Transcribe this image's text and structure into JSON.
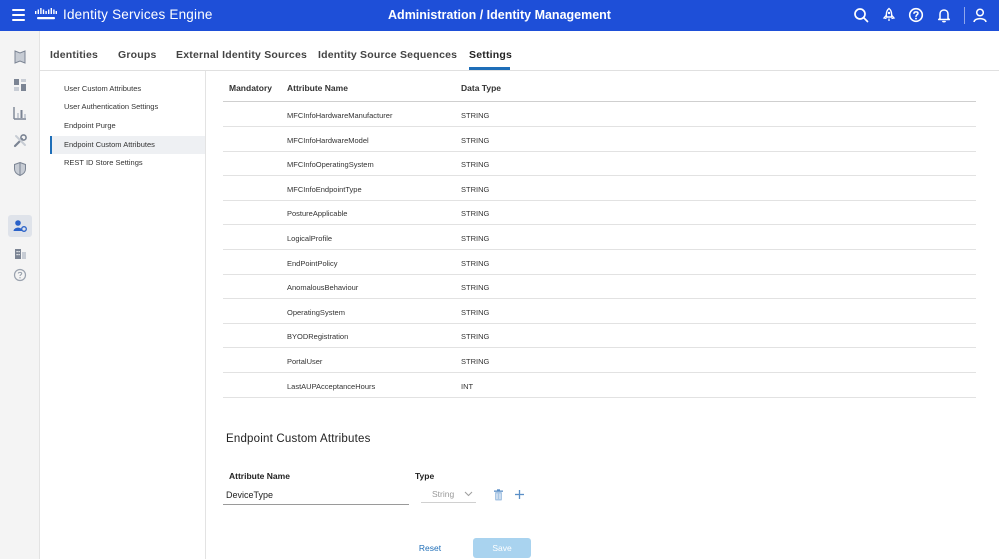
{
  "header": {
    "app_title": "Identity Services Engine",
    "page_heading": "Administration / Identity Management",
    "background": "#1e4fd8"
  },
  "tabs": [
    {
      "label": "Identities"
    },
    {
      "label": "Groups"
    },
    {
      "label": "External Identity Sources"
    },
    {
      "label": "Identity Source Sequences"
    },
    {
      "label": "Settings",
      "active": true
    }
  ],
  "side_menu": {
    "items": [
      {
        "label": "User Custom Attributes"
      },
      {
        "label": "User Authentication Settings"
      },
      {
        "label": "Endpoint Purge"
      },
      {
        "label": "Endpoint Custom Attributes",
        "active": true
      },
      {
        "label": "REST ID Store Settings"
      }
    ]
  },
  "table": {
    "columns": [
      "Mandatory",
      "Attribute Name",
      "Data Type"
    ],
    "rows": [
      {
        "name": "MFCInfoHardwareManufacturer",
        "type": "STRING"
      },
      {
        "name": "MFCInfoHardwareModel",
        "type": "STRING"
      },
      {
        "name": "MFCInfoOperatingSystem",
        "type": "STRING"
      },
      {
        "name": "MFCInfoEndpointType",
        "type": "STRING"
      },
      {
        "name": "PostureApplicable",
        "type": "STRING"
      },
      {
        "name": "LogicalProfile",
        "type": "STRING"
      },
      {
        "name": "EndPointPolicy",
        "type": "STRING"
      },
      {
        "name": "AnomalousBehaviour",
        "type": "STRING"
      },
      {
        "name": "OperatingSystem",
        "type": "STRING"
      },
      {
        "name": "BYODRegistration",
        "type": "STRING"
      },
      {
        "name": "PortalUser",
        "type": "STRING"
      },
      {
        "name": "LastAUPAcceptanceHours",
        "type": "INT"
      }
    ]
  },
  "form": {
    "section_title": "Endpoint Custom Attributes",
    "attribute_name_label": "Attribute Name",
    "type_label": "Type",
    "attribute_name_value": "DeviceType",
    "type_value": "String"
  },
  "buttons": {
    "reset_label": "Reset",
    "save_label": "Save"
  },
  "colors": {
    "accent": "#1e6eb8",
    "save_disabled": "#a9d3ef"
  }
}
